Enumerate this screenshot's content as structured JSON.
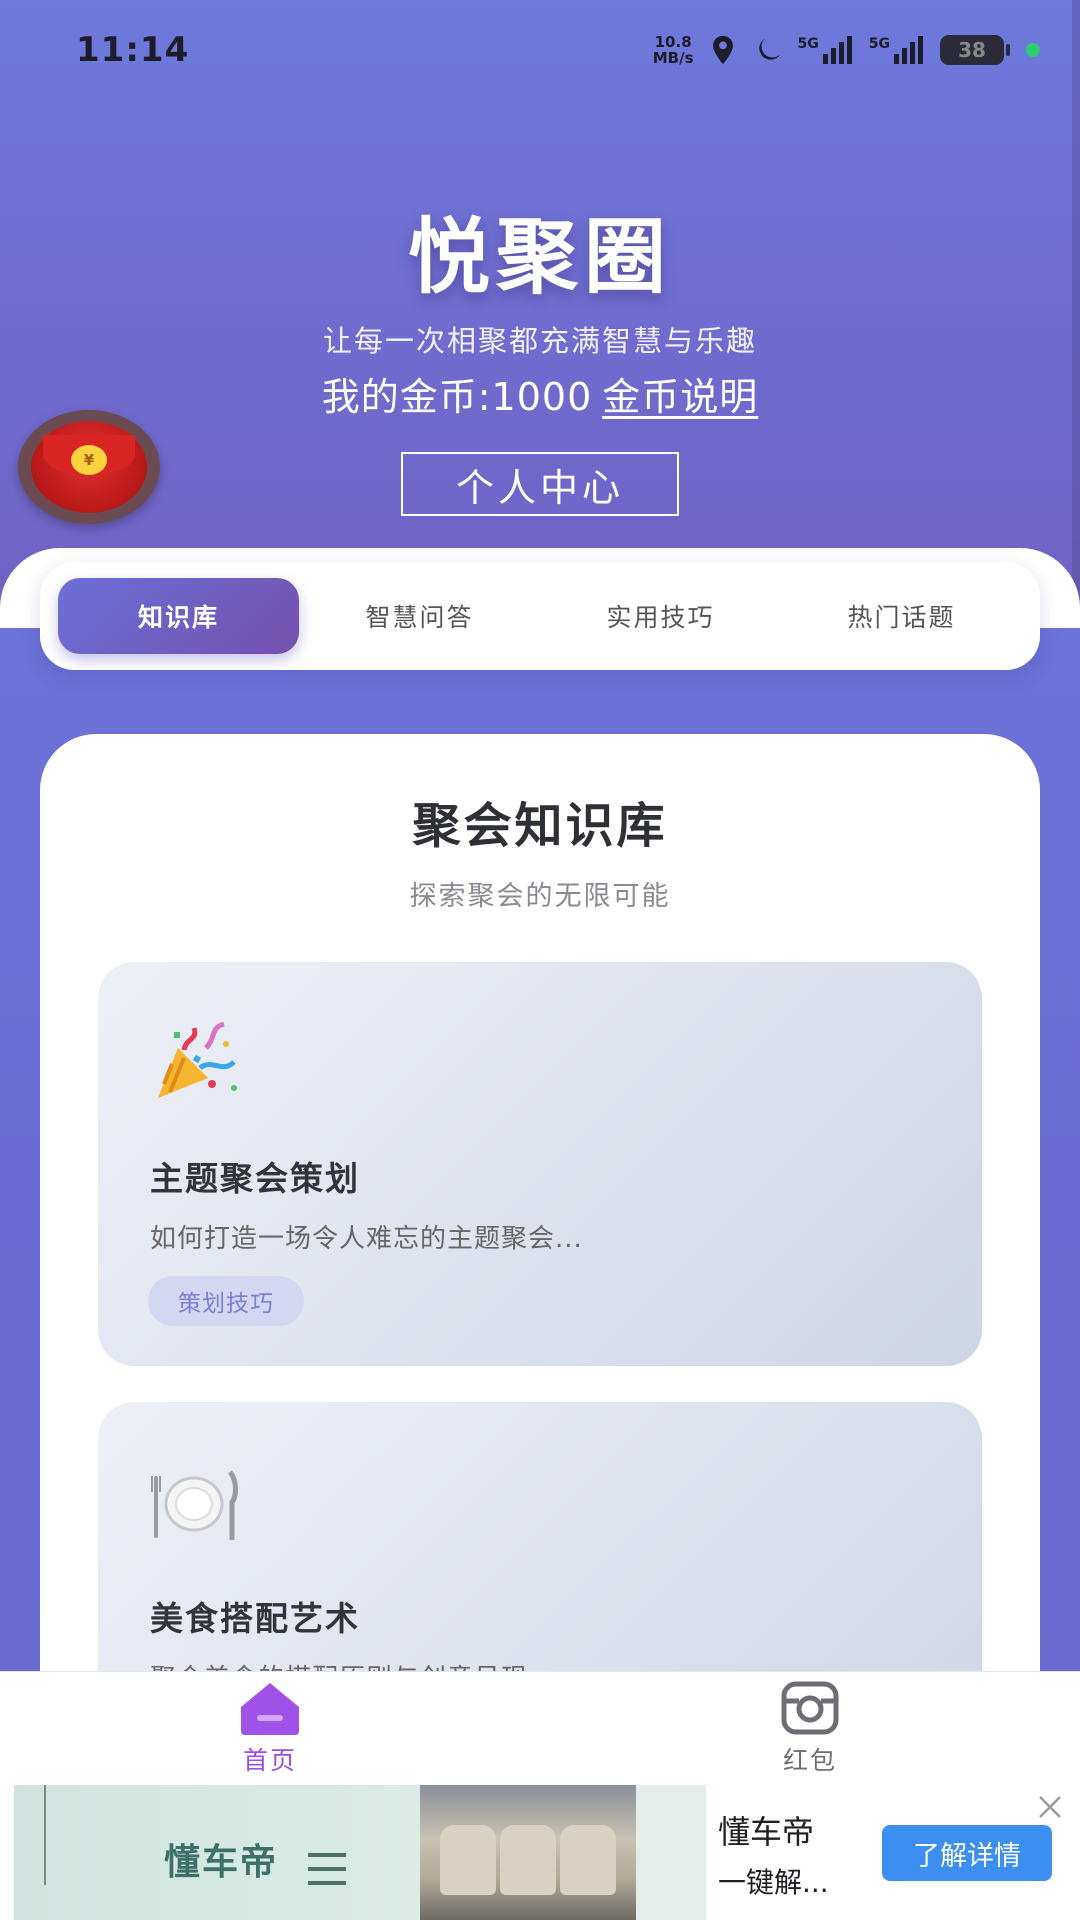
{
  "status_bar": {
    "time": "11:14",
    "net_speed_value": "10.8",
    "net_speed_unit": "MB/s",
    "signal_1": "5G",
    "signal_2": "5G",
    "battery": "38"
  },
  "header": {
    "title": "悦聚圈",
    "subtitle": "让每一次相聚都充满智慧与乐趣",
    "coins_text": "我的金币:1000",
    "coins_link": "金币说明",
    "profile_button": "个人中心"
  },
  "floating_red_packet": {
    "icon": "red-envelope-icon",
    "symbol": "¥"
  },
  "tabs": [
    {
      "label": "知识库",
      "active": true
    },
    {
      "label": "智慧问答",
      "active": false
    },
    {
      "label": "实用技巧",
      "active": false
    },
    {
      "label": "热门话题",
      "active": false
    }
  ],
  "section": {
    "title": "聚会知识库",
    "subtitle": "探索聚会的无限可能"
  },
  "cards": [
    {
      "icon": "party-popper-icon",
      "title": "主题聚会策划",
      "desc": "如何打造一场令人难忘的主题聚会...",
      "tag": "策划技巧"
    },
    {
      "icon": "plate-cutlery-icon",
      "title": "美食搭配艺术",
      "desc": "聚会美食的搭配原则与创意呈现"
    }
  ],
  "bottom_nav": [
    {
      "label": "首页",
      "icon": "home-icon",
      "active": true
    },
    {
      "label": "红包",
      "icon": "camera-icon",
      "active": false
    }
  ],
  "ad": {
    "left_brand": "懂车帝",
    "brand": "懂车帝",
    "desc": "一键解...",
    "cta": "了解详情"
  },
  "colors": {
    "accent_start": "#6b6fd8",
    "accent_end": "#7451ad",
    "nav_active": "#9b4fe0",
    "tag_bg": "#d3d7f2",
    "ad_cta": "#3c8ef0"
  }
}
